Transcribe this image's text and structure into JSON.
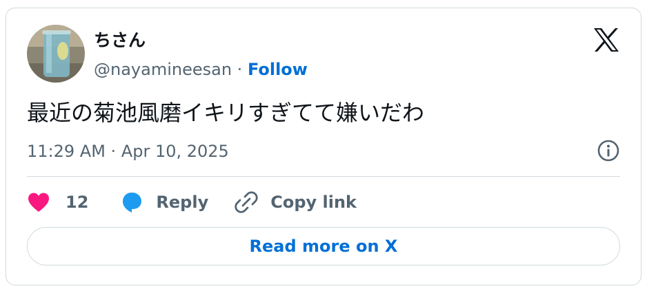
{
  "author": {
    "display_name": "ちさん",
    "handle": "@nayamineesan",
    "separator": " · ",
    "follow_label": "Follow"
  },
  "tweet": {
    "text": "最近の菊池風磨イキリすぎてて嫌いだわ",
    "timestamp": "11:29 AM · Apr 10, 2025"
  },
  "actions": {
    "like_count": "12",
    "reply_label": "Reply",
    "copy_link_label": "Copy link"
  },
  "read_more_label": "Read more on X",
  "icons": {
    "logo": "x-logo-icon",
    "info": "info-icon",
    "like": "heart-icon",
    "reply": "speech-bubble-icon",
    "copy": "link-icon"
  },
  "colors": {
    "link": "#006fd6",
    "like": "#f91880",
    "reply": "#1d9bf0",
    "muted": "#536471",
    "border": "#cfd9de"
  }
}
